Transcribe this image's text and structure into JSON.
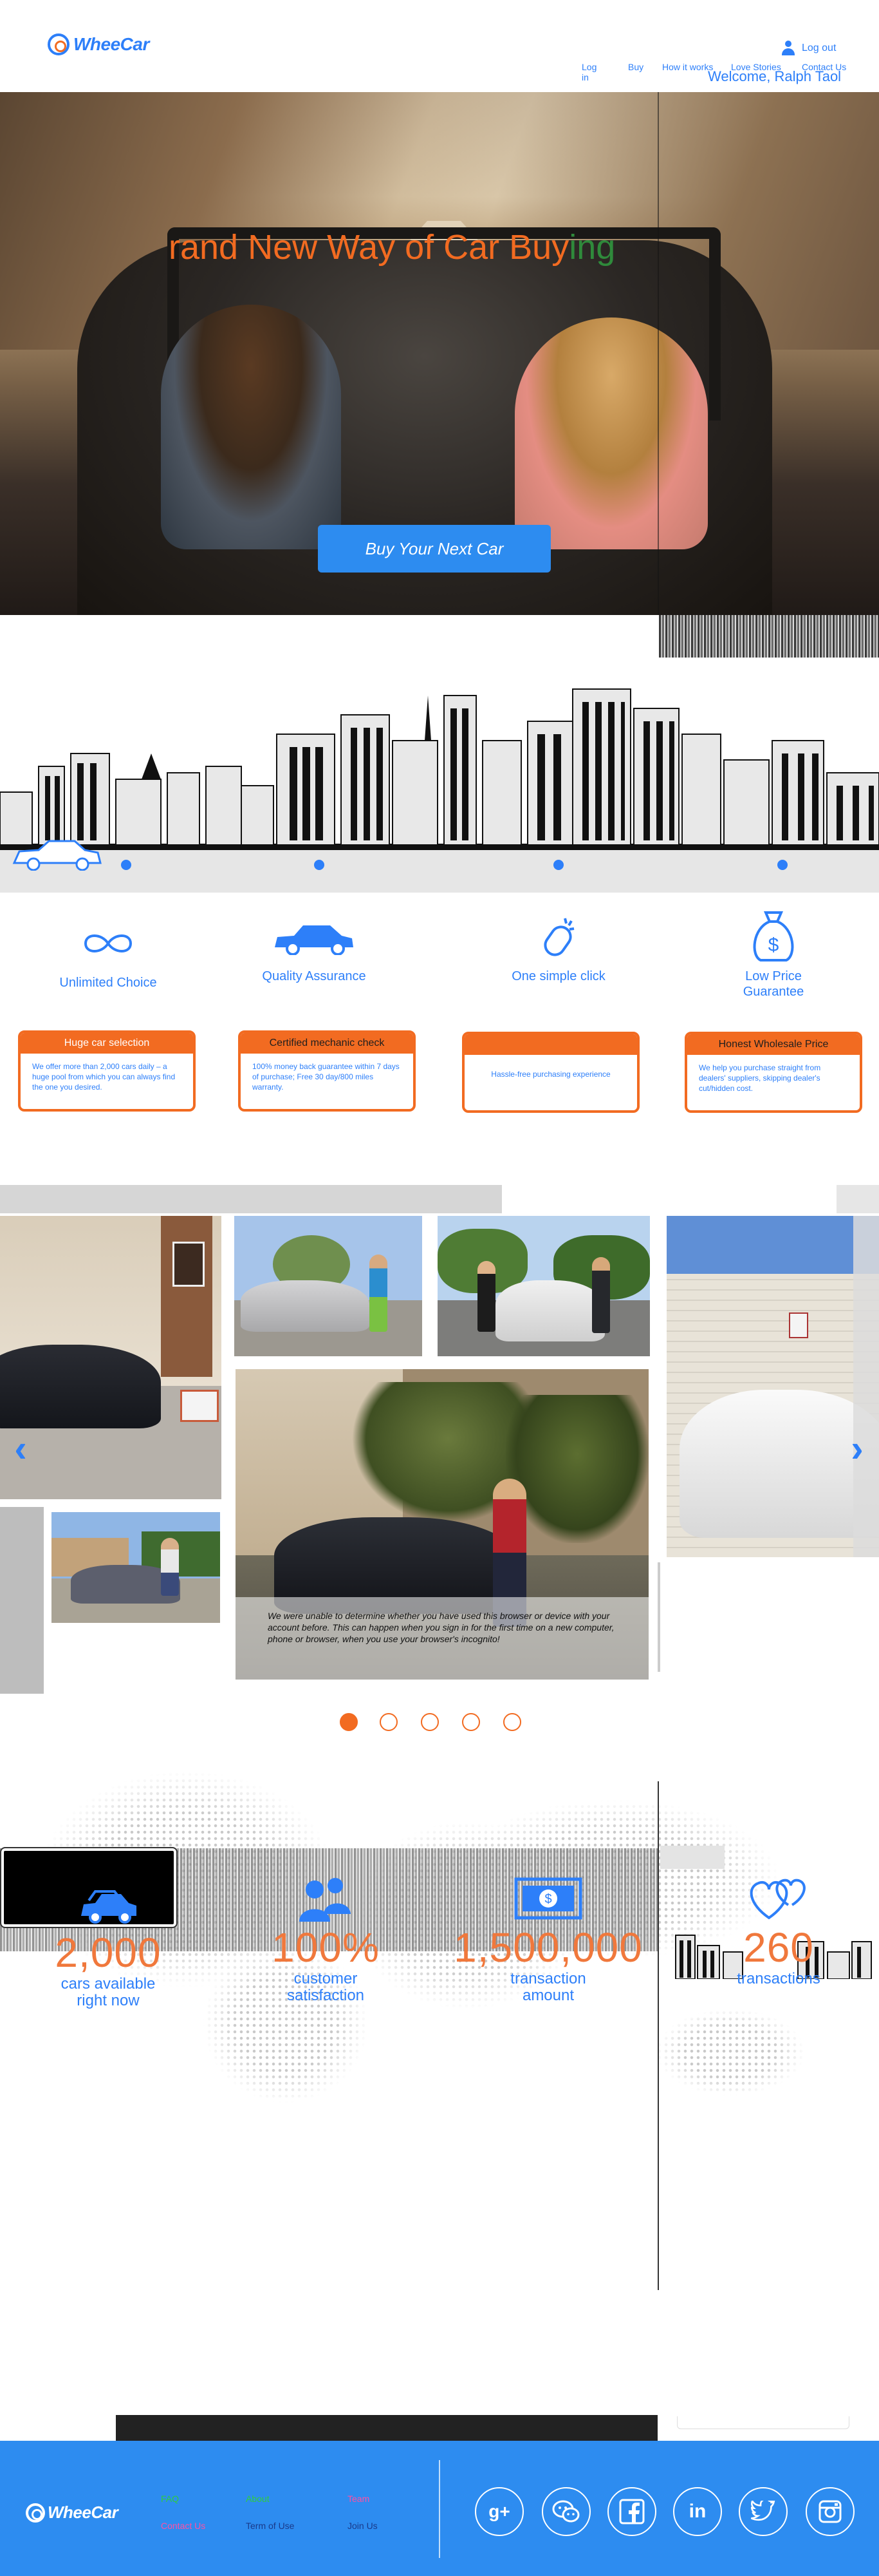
{
  "header": {
    "brand": "WheeCar",
    "nav": [
      "Log in",
      "Buy",
      "How it works",
      "Love Stories",
      "Contact Us"
    ],
    "logout_label": "Log out",
    "welcome": "Welcome, Ralph Taol"
  },
  "hero": {
    "title_main": "rand New Way of Car Buy",
    "title_tail": "ing",
    "cta": "Buy Your Next Car"
  },
  "features": [
    {
      "title": "Unlimited Choice",
      "card_title": "Huge car selection",
      "card_text": "We offer more than 2,000 cars daily – a huge pool from which you can always find the one you desired.",
      "icon": "infinity-icon"
    },
    {
      "title": "Quality Assurance",
      "card_title": "Certified mechanic check",
      "card_text": "100% money back guarantee within 7 days of purchase; Free 30 day/800 miles warranty.",
      "icon": "car-icon"
    },
    {
      "title": "One simple click",
      "card_title": "",
      "card_text": "Hassle-free purchasing experience",
      "icon": "mouse-click-icon"
    },
    {
      "title": "Low Price Guarantee",
      "card_title": "Honest Wholesale Price",
      "card_text": "We help you purchase straight from dealers' suppliers, skipping dealer's cut/hidden cost.",
      "icon": "money-bag-icon"
    }
  ],
  "gallery": {
    "caption": "We were unable to determine whether you have used this browser or device with your account before. This can happen when you sign in for the first time on a new computer, phone or browser, when you use your browser's incognito!",
    "pages": 5,
    "active_page": 1
  },
  "stats": [
    {
      "value": "2,000",
      "label": "cars available right now",
      "icon": "car-fleet-icon"
    },
    {
      "value": "100%",
      "label": "customer satisfaction",
      "icon": "people-icon"
    },
    {
      "value": "1,500,000",
      "label": "transaction amount",
      "icon": "money-icon"
    },
    {
      "value": "260",
      "label": "transactions",
      "icon": "hearts-icon"
    }
  ],
  "footer": {
    "brand": "WheeCar",
    "links": [
      {
        "label": "FAQ",
        "color": "#2ecc40"
      },
      {
        "label": "About",
        "color": "#2ecc40"
      },
      {
        "label": "Team",
        "color": "#ff4fa3"
      },
      {
        "label": "Contact Us",
        "color": "#ff4fa3"
      },
      {
        "label": "Term of Use",
        "color": "#1a3a8a"
      },
      {
        "label": "Join Us",
        "color": "#1a3a8a"
      }
    ],
    "social": [
      "google-plus-icon",
      "wechat-icon",
      "facebook-icon",
      "linkedin-icon",
      "twitter-icon",
      "instagram-icon"
    ]
  },
  "colors": {
    "brand_blue": "#2d7ff9",
    "brand_orange": "#f26b21",
    "footer_blue": "#2d8cf0"
  }
}
